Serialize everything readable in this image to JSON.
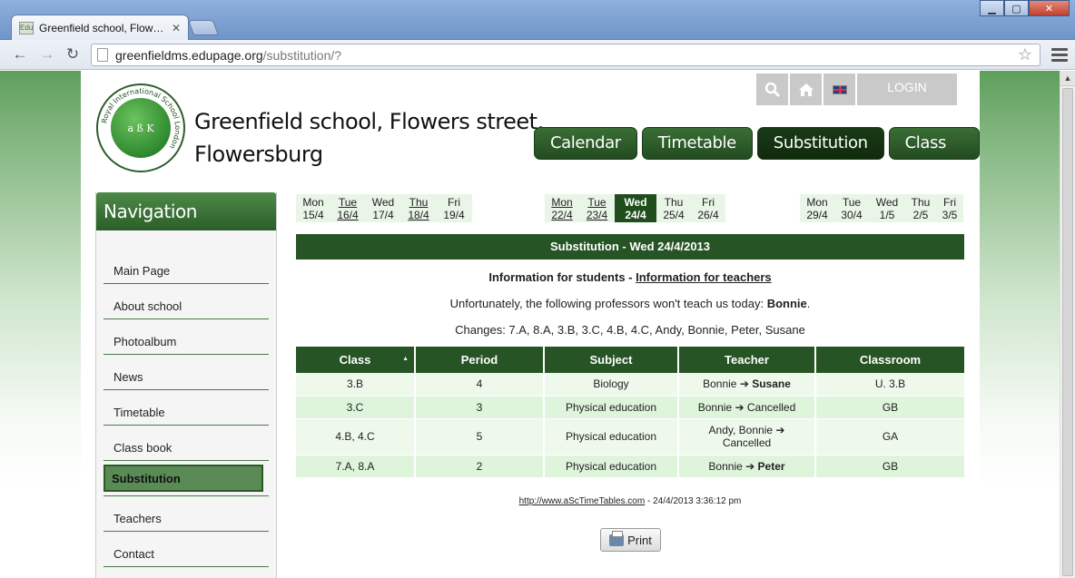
{
  "browser": {
    "tab_title": "Greenfield school, Flowers st",
    "tab_favicon": "Edu",
    "url_host": "greenfieldms.edupage.org",
    "url_path": "/substitution/?"
  },
  "header": {
    "site_title_line1": "Greenfield school, Flowers street,",
    "site_title_line2": "Flowersburg",
    "logo_text": "Royal International School London",
    "login_label": "LOGIN",
    "top_icons": [
      "search-icon",
      "home-icon",
      "uk-flag-icon"
    ]
  },
  "mainnav": {
    "items": [
      "Calendar",
      "Timetable",
      "Substitution",
      "Class book"
    ],
    "active": "Substitution"
  },
  "sidebar": {
    "title": "Navigation",
    "items": [
      "Main Page",
      "About school",
      "Photoalbum",
      "News",
      "Timetable",
      "Class book",
      "Substitution",
      "Teachers",
      "Contact"
    ],
    "active": "Substitution"
  },
  "weeks": [
    [
      {
        "name": "Mon",
        "date": "15/4",
        "link": false
      },
      {
        "name": "Tue",
        "date": "16/4",
        "link": true
      },
      {
        "name": "Wed",
        "date": "17/4",
        "link": false
      },
      {
        "name": "Thu",
        "date": "18/4",
        "link": true
      },
      {
        "name": "Fri",
        "date": "19/4",
        "link": false
      }
    ],
    [
      {
        "name": "Mon",
        "date": "22/4",
        "link": true
      },
      {
        "name": "Tue",
        "date": "23/4",
        "link": true
      },
      {
        "name": "Wed",
        "date": "24/4",
        "link": false,
        "current": true
      },
      {
        "name": "Thu",
        "date": "25/4",
        "link": false
      },
      {
        "name": "Fri",
        "date": "26/4",
        "link": false
      }
    ],
    [
      {
        "name": "Mon",
        "date": "29/4",
        "link": false
      },
      {
        "name": "Tue",
        "date": "30/4",
        "link": false
      },
      {
        "name": "Wed",
        "date": "1/5",
        "link": false
      },
      {
        "name": "Thu",
        "date": "2/5",
        "link": false
      },
      {
        "name": "Fri",
        "date": "3/5",
        "link": false
      }
    ]
  ],
  "content": {
    "banner": "Substitution - Wed 24/4/2013",
    "info_students": "Information for students",
    "info_sep": " - ",
    "info_teachers": "Information for teachers",
    "absent_prefix": "Unfortunately, the following professors won't teach us today: ",
    "absent_names": "Bonnie",
    "absent_suffix": ".",
    "changes": "Changes: 7.A, 8.A, 3.B, 3.C, 4.B, 4.C, Andy, Bonnie, Peter, Susane",
    "table": {
      "headers": [
        "Class",
        "Period",
        "Subject",
        "Teacher",
        "Classroom"
      ],
      "rows": [
        {
          "class": "3.B",
          "period": "4",
          "subject": "Biology",
          "teacher_from": "Bonnie",
          "arrow": "➔",
          "teacher_to": "Susane",
          "to_bold": true,
          "classroom": "U. 3.B"
        },
        {
          "class": "3.C",
          "period": "3",
          "subject": "Physical education",
          "teacher_from": "Bonnie",
          "arrow": "➔",
          "teacher_to": "Cancelled",
          "to_bold": false,
          "classroom": "GB"
        },
        {
          "class": "4.B, 4.C",
          "period": "5",
          "subject": "Physical education",
          "teacher_from": "Andy, Bonnie",
          "arrow": "➔",
          "teacher_to": "Cancelled",
          "to_bold": false,
          "classroom": "GA"
        },
        {
          "class": "7.A, 8.A",
          "period": "2",
          "subject": "Physical education",
          "teacher_from": "Bonnie",
          "arrow": "➔",
          "teacher_to": "Peter",
          "to_bold": true,
          "classroom": "GB"
        }
      ]
    },
    "footer_link": "http://www.aScTimeTables.com",
    "footer_time": " - 24/4/2013 3:36:12 pm",
    "print_label": "Print"
  }
}
